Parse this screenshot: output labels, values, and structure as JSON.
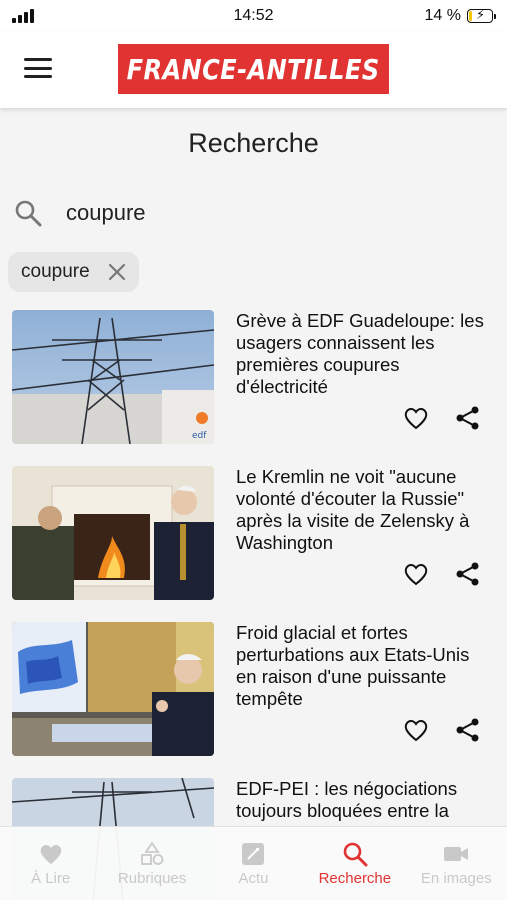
{
  "status_bar": {
    "time": "14:52",
    "battery": "14 %"
  },
  "header": {
    "logo_text": "FRANCE-ANTILLES",
    "brand_color": "#e03332"
  },
  "page": {
    "title": "Recherche"
  },
  "search": {
    "value": "coupure",
    "icon": "search-icon"
  },
  "filter_chip": {
    "label": "coupure",
    "icon": "close-icon"
  },
  "articles": [
    {
      "title": "Grève à EDF Guadeloupe: les usagers connaissent les premières coupures d'électricité",
      "image": "power-pylon-photo"
    },
    {
      "title": "Le Kremlin ne voit \"aucune volonté d'écouter la Russie\" après la visite de Zelensky à Washington",
      "image": "oval-office-fireplace-photo"
    },
    {
      "title": "Froid glacial et fortes perturbations aux Etats-Unis en raison d'une puissante tempête",
      "image": "press-briefing-weather-map-photo"
    },
    {
      "title": "EDF-PEI : les négociations toujours bloquées entre la",
      "image": "power-lines-photo"
    }
  ],
  "bottom_nav": {
    "items": [
      {
        "label": "À Lire",
        "icon": "heart-icon",
        "active": false
      },
      {
        "label": "Rubriques",
        "icon": "shapes-icon",
        "active": false
      },
      {
        "label": "Actu",
        "icon": "newspaper-icon",
        "active": false
      },
      {
        "label": "Recherche",
        "icon": "search-icon",
        "active": true
      },
      {
        "label": "En images",
        "icon": "video-camera-icon",
        "active": false
      }
    ],
    "active_color": "#e03332",
    "inactive_color": "#c9c9c9"
  }
}
